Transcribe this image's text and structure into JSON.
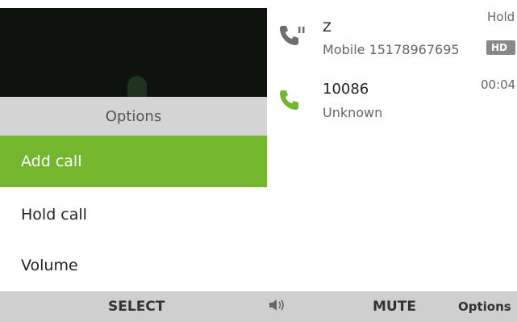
{
  "options_menu": {
    "title": "Options",
    "items": [
      {
        "label": "Add call",
        "selected": true
      },
      {
        "label": "Hold call",
        "selected": false
      },
      {
        "label": "Volume",
        "selected": false
      }
    ]
  },
  "calls": [
    {
      "name": "Z",
      "detail": "Mobile 15178967695",
      "status": "Hold",
      "badge": "HD",
      "icon": "phone-hold-icon"
    },
    {
      "name": "10086",
      "detail": "Unknown",
      "timer": "00:04",
      "icon": "phone-active-icon"
    }
  ],
  "softkeys": {
    "left": "SELECT",
    "middle_icon": "volume-icon",
    "center": "MUTE",
    "right": "Options"
  },
  "colors": {
    "accent": "#74b72e",
    "header_bg": "#d4d4d4",
    "softkey_bg": "#cfcfcf",
    "video_bg": "#0e130e",
    "phone_hold": "#6e6e6e",
    "phone_active": "#74b72e"
  }
}
